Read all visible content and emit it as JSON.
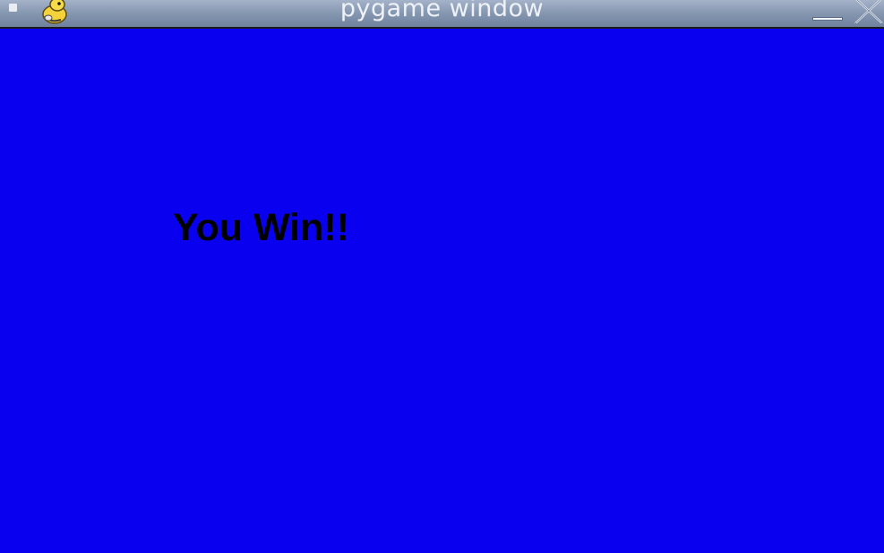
{
  "window": {
    "title": "pygame window",
    "icons": {
      "menu": "window-menu-icon",
      "app": "pygame-snake-icon",
      "minimize": "minimize-icon",
      "close": "close-icon"
    }
  },
  "game": {
    "message": "You Win!!",
    "background_color": "#0a00f0",
    "text_color": "#000000"
  }
}
